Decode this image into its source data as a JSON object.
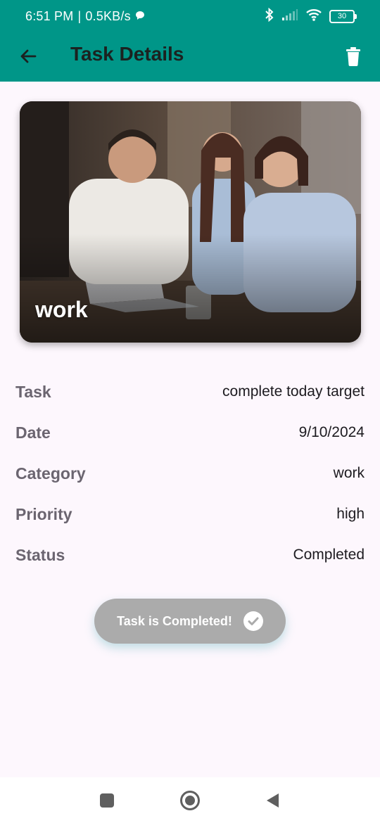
{
  "status_bar": {
    "time": "6:51 PM",
    "separator": "|",
    "net_speed": "0.5KB/s",
    "battery_level": "30",
    "icons": [
      "chat-bubble-icon",
      "bluetooth-icon",
      "signal-icon",
      "wifi-icon",
      "battery-icon"
    ]
  },
  "app_bar": {
    "title": "Task Details",
    "back_icon": "arrow-left-icon",
    "delete_icon": "trash-icon",
    "background_color": "#009688"
  },
  "hero": {
    "category_label": "work",
    "image": "photo of three people working on a laptop"
  },
  "details": [
    {
      "label": "Task",
      "value": "complete today target"
    },
    {
      "label": "Date",
      "value": "9/10/2024"
    },
    {
      "label": "Category",
      "value": "work"
    },
    {
      "label": "Priority",
      "value": "high"
    },
    {
      "label": "Status",
      "value": "Completed"
    }
  ],
  "toast": {
    "message": "Task is Completed!",
    "icon": "check-circle-icon"
  },
  "nav_bar": {
    "icons": [
      "recents-square-icon",
      "home-circle-icon",
      "back-triangle-icon"
    ]
  },
  "colors": {
    "primary": "#009688",
    "background": "#FDF7FD",
    "toast_bg": "#ABABAB",
    "label": "#6B6570"
  }
}
